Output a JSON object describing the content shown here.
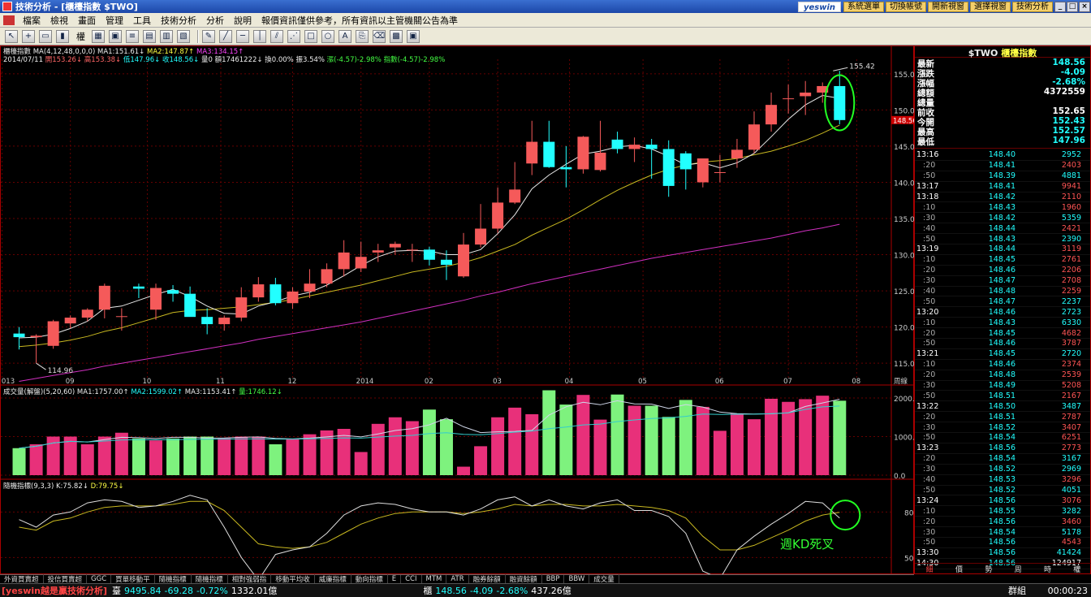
{
  "window": {
    "title": "技術分析 - [櫃檯指數 $TWO]",
    "brand": "yeswin",
    "buttons": [
      "系統選單",
      "切換帳號",
      "開新視窗",
      "選擇視窗",
      "技術分析"
    ]
  },
  "menu": [
    "檔案",
    "檢視",
    "畫面",
    "管理",
    "工具",
    "技術分析",
    "分析",
    "說明",
    "報價資訊僅供參考，所有資訊以主管機關公告為準"
  ],
  "toolbar": {
    "period": "權"
  },
  "kchart": {
    "name": "櫃檯指數",
    "ma_param": "MA(4,12,48,0,0,0)",
    "ma1": "MA1:151.61↓",
    "ma2": "MA2:147.87↑",
    "ma3": "MA3:134.15↑",
    "date": "2014/07/11",
    "open": "開153.26↓",
    "high": "高153.38↓",
    "low": "低147.96↓",
    "close": "收148.56↓",
    "vol": "量0",
    "amount": "額17461222↓",
    "turnover": "換0.00%",
    "amp": "振3.54%",
    "chg": "漲(-4.57)-2.98%",
    "idx": "指數(-4.57)-2.98%",
    "hi_label": "155.42",
    "lo_label": "114.96",
    "cur_price": "148.56",
    "yticks": [
      "155.00",
      "150.00",
      "145.00",
      "140.00",
      "135.00",
      "130.00",
      "125.00",
      "120.00",
      "115.00"
    ],
    "xlabels": [
      "2013",
      "09",
      "10",
      "11",
      "12",
      "2014",
      "02",
      "03",
      "04",
      "05",
      "06",
      "07",
      "08"
    ],
    "period": "周線",
    "annot": "週KD死叉"
  },
  "vchart": {
    "title": "成交量(解盤)(5,20,60)",
    "ma1": "MA1:1757.00↑",
    "ma2": "MA2:1599.02↑",
    "ma3": "MA3:1153.41↑",
    "amt": "量:1746.12↓",
    "yticks": [
      "2000.0",
      "1000.0",
      "0.0"
    ]
  },
  "kdchart": {
    "title": "隨機指標(9,3,3)",
    "k": "K:75.82↓",
    "d": "D:79.75↓",
    "yticks": [
      "80",
      "50"
    ]
  },
  "chart_data": {
    "type": "candlestick",
    "x": [
      "2013-08-02",
      "2013-08-09",
      "2013-08-16",
      "2013-08-23",
      "2013-08-30",
      "2013-09-06",
      "2013-09-13",
      "2013-09-20",
      "2013-09-27",
      "2013-10-04",
      "2013-10-11",
      "2013-10-18",
      "2013-10-25",
      "2013-11-01",
      "2013-11-08",
      "2013-11-15",
      "2013-11-22",
      "2013-11-29",
      "2013-12-06",
      "2013-12-13",
      "2013-12-20",
      "2013-12-27",
      "2014-01-03",
      "2014-01-10",
      "2014-01-17",
      "2014-01-24",
      "2014-02-07",
      "2014-02-14",
      "2014-02-21",
      "2014-02-28",
      "2014-03-07",
      "2014-03-14",
      "2014-03-21",
      "2014-03-28",
      "2014-04-03",
      "2014-04-11",
      "2014-04-18",
      "2014-04-25",
      "2014-05-02",
      "2014-05-09",
      "2014-05-16",
      "2014-05-23",
      "2014-05-30",
      "2014-06-06",
      "2014-06-13",
      "2014-06-20",
      "2014-06-27",
      "2014-07-04",
      "2014-07-11"
    ],
    "open": [
      119.1,
      118.6,
      117.4,
      120.5,
      121.3,
      122.4,
      121.4,
      125.6,
      122.4,
      125.1,
      124.6,
      121.4,
      120.4,
      121.3,
      124.1,
      125.9,
      123.3,
      124.9,
      126.0,
      128.0,
      128.1,
      130.3,
      131.0,
      130.6,
      130.7,
      129.3,
      127.0,
      131.4,
      133.6,
      137.2,
      142.6,
      145.6,
      142.1,
      141.8,
      141.7,
      145.9,
      144.6,
      145.2,
      144.6,
      144.0,
      140.0,
      141.4,
      143.3,
      144.5,
      148.0,
      151.6,
      151.9,
      152.4,
      153.3
    ],
    "high": [
      120.0,
      119.0,
      121.0,
      121.6,
      122.6,
      126.0,
      122.6,
      126.0,
      126.0,
      125.8,
      125.6,
      122.6,
      121.6,
      125.5,
      126.9,
      126.8,
      125.5,
      128.0,
      128.8,
      132.0,
      131.8,
      131.5,
      131.8,
      131.5,
      131.1,
      130.6,
      133.0,
      137.0,
      139.3,
      142.8,
      148.5,
      148.5,
      145.0,
      146.4,
      148.5,
      147.0,
      146.2,
      146.0,
      145.8,
      144.3,
      142.5,
      143.8,
      146.0,
      149.8,
      152.4,
      153.5,
      154.0,
      153.8,
      155.4
    ],
    "low": [
      116.9,
      115.0,
      117.0,
      119.8,
      120.8,
      121.2,
      119.5,
      124.0,
      121.0,
      123.5,
      121.5,
      119.0,
      119.5,
      120.8,
      123.5,
      123.0,
      122.5,
      124.0,
      125.5,
      127.0,
      127.6,
      129.0,
      130.0,
      129.0,
      128.5,
      126.5,
      126.8,
      131.0,
      133.0,
      137.0,
      141.0,
      142.0,
      139.3,
      141.2,
      141.5,
      144.0,
      142.8,
      140.5,
      138.0,
      139.0,
      139.3,
      140.0,
      142.0,
      144.0,
      147.0,
      149.5,
      149.3,
      151.0,
      148.0
    ],
    "close": [
      118.6,
      118.8,
      120.8,
      121.3,
      122.4,
      125.7,
      121.5,
      125.3,
      125.4,
      124.6,
      121.4,
      120.4,
      121.3,
      124.1,
      125.9,
      123.3,
      124.9,
      126.0,
      128.0,
      130.3,
      129.7,
      130.6,
      131.5,
      130.7,
      129.3,
      128.6,
      131.4,
      133.6,
      137.2,
      139.0,
      145.6,
      142.1,
      141.8,
      146.3,
      144.1,
      144.6,
      145.2,
      144.6,
      139.5,
      141.8,
      143.3,
      141.4,
      144.5,
      148.0,
      150.7,
      151.6,
      152.4,
      153.3,
      148.6
    ],
    "ma1": [
      118.5,
      118.6,
      119.0,
      119.8,
      120.8,
      122.6,
      122.9,
      123.7,
      124.5,
      125.2,
      124.2,
      122.9,
      121.9,
      121.8,
      122.9,
      123.5,
      124.3,
      124.8,
      125.8,
      127.1,
      128.5,
      129.7,
      130.5,
      130.6,
      130.5,
      130.0,
      130.0,
      130.7,
      132.9,
      135.5,
      139.1,
      141.0,
      142.5,
      143.9,
      144.3,
      144.9,
      145.1,
      144.6,
      143.6,
      142.4,
      142.7,
      142.0,
      142.7,
      144.0,
      146.3,
      148.7,
      150.7,
      152.0,
      151.6
    ],
    "ma2": [
      117.3,
      117.5,
      117.8,
      118.2,
      118.7,
      119.4,
      119.9,
      120.6,
      121.3,
      122.0,
      122.3,
      122.4,
      122.6,
      122.8,
      123.1,
      123.4,
      123.8,
      124.3,
      124.8,
      125.3,
      125.8,
      126.4,
      127.0,
      127.6,
      128.0,
      128.4,
      128.9,
      129.6,
      130.5,
      131.4,
      132.7,
      133.8,
      134.9,
      136.2,
      137.6,
      138.9,
      140.0,
      141.0,
      141.8,
      142.4,
      142.8,
      143.0,
      143.3,
      143.8,
      144.3,
      145.0,
      145.8,
      146.8,
      147.9
    ],
    "ma3": [
      112.5,
      112.9,
      113.3,
      113.7,
      114.1,
      114.6,
      115.0,
      115.4,
      115.8,
      116.2,
      116.6,
      117.0,
      117.4,
      117.8,
      118.3,
      118.7,
      119.1,
      119.5,
      119.9,
      120.3,
      120.7,
      121.2,
      121.7,
      122.2,
      122.7,
      123.2,
      123.7,
      124.3,
      124.8,
      125.4,
      126.0,
      126.5,
      127.0,
      127.5,
      128.0,
      128.5,
      129.0,
      129.5,
      129.9,
      130.3,
      130.7,
      131.1,
      131.5,
      131.9,
      132.3,
      132.8,
      133.3,
      133.7,
      134.2
    ],
    "volume": [
      700,
      800,
      1000,
      1000,
      800,
      1000,
      1100,
      950,
      900,
      950,
      1000,
      1000,
      960,
      1000,
      1000,
      800,
      940,
      1060,
      1160,
      1200,
      600,
      1330,
      1500,
      1400,
      1700,
      1450,
      220,
      750,
      1500,
      1750,
      1580,
      2200,
      1830,
      2080,
      1440,
      2090,
      1800,
      1800,
      1510,
      1950,
      1770,
      1150,
      1600,
      1450,
      1980,
      1900,
      1970,
      2060,
      1930
    ],
    "k": [
      75,
      70,
      78,
      80,
      86,
      88,
      87,
      83,
      84,
      87,
      91,
      88,
      70,
      50,
      35,
      52,
      55,
      57,
      66,
      78,
      84,
      86,
      85,
      82,
      80,
      80,
      78,
      82,
      88,
      90,
      84,
      88,
      84,
      82,
      86,
      88,
      81,
      81,
      77,
      66,
      41,
      36,
      55,
      64,
      72,
      79,
      87,
      86,
      76
    ],
    "d": [
      70,
      68,
      74,
      76,
      80,
      83,
      84,
      84,
      84,
      85,
      87,
      87,
      81,
      70,
      59,
      57,
      56,
      57,
      60,
      66,
      72,
      76,
      79,
      80,
      80,
      80,
      79,
      80,
      82,
      85,
      84,
      85,
      85,
      84,
      84,
      85,
      84,
      83,
      81,
      76,
      64,
      55,
      55,
      58,
      63,
      68,
      74,
      78,
      79.75
    ],
    "ylim": [
      113,
      157
    ],
    "vol_ylim": [
      0,
      2000
    ],
    "kd_ylim": [
      40,
      100
    ]
  },
  "quote": {
    "title_code": "$TWO",
    "title_name": "櫃檯指數",
    "rows": [
      [
        "最新",
        "148.56",
        "c"
      ],
      [
        "漲跌",
        "-4.09",
        "c"
      ],
      [
        "漲幅",
        "-2.68%",
        "c"
      ],
      [
        "總額",
        "4372559",
        "w"
      ],
      [
        "總量",
        "",
        "w"
      ],
      [
        "前收",
        "152.65",
        "w"
      ],
      [
        "今開",
        "152.43",
        "c"
      ],
      [
        "最高",
        "152.57",
        "c"
      ],
      [
        "最低",
        "147.96",
        "c"
      ]
    ]
  },
  "ticks": [
    [
      "13:16",
      "148.40",
      "2952",
      "c",
      0
    ],
    [
      ":20",
      "148.41",
      "2403",
      "r",
      1
    ],
    [
      ":50",
      "148.39",
      "4881",
      "c",
      1
    ],
    [
      "13:17",
      "148.41",
      "9941",
      "r",
      0
    ],
    [
      "13:18",
      "148.42",
      "2110",
      "r",
      0
    ],
    [
      ":10",
      "148.43",
      "1960",
      "r",
      1
    ],
    [
      ":30",
      "148.42",
      "5359",
      "c",
      1
    ],
    [
      ":40",
      "148.44",
      "2421",
      "r",
      1
    ],
    [
      ":50",
      "148.43",
      "2390",
      "c",
      1
    ],
    [
      "13:19",
      "148.44",
      "3119",
      "r",
      0
    ],
    [
      ":10",
      "148.45",
      "2761",
      "r",
      1
    ],
    [
      ":20",
      "148.46",
      "2206",
      "r",
      1
    ],
    [
      ":30",
      "148.47",
      "2708",
      "r",
      1
    ],
    [
      ":40",
      "148.48",
      "2259",
      "r",
      1
    ],
    [
      ":50",
      "148.47",
      "2237",
      "c",
      1
    ],
    [
      "13:20",
      "148.46",
      "2723",
      "c",
      0
    ],
    [
      ":10",
      "148.43",
      "6330",
      "c",
      1
    ],
    [
      ":20",
      "148.45",
      "4682",
      "r",
      1
    ],
    [
      ":50",
      "148.46",
      "3787",
      "r",
      1
    ],
    [
      "13:21",
      "148.45",
      "2720",
      "c",
      0
    ],
    [
      ":10",
      "148.46",
      "2374",
      "r",
      1
    ],
    [
      ":20",
      "148.48",
      "2539",
      "r",
      1
    ],
    [
      ":30",
      "148.49",
      "5208",
      "r",
      1
    ],
    [
      ":50",
      "148.51",
      "2167",
      "r",
      1
    ],
    [
      "13:22",
      "148.50",
      "3487",
      "c",
      0
    ],
    [
      ":20",
      "148.51",
      "2787",
      "r",
      1
    ],
    [
      ":30",
      "148.52",
      "3407",
      "r",
      1
    ],
    [
      ":50",
      "148.54",
      "6251",
      "r",
      1
    ],
    [
      "13:23",
      "148.56",
      "2773",
      "r",
      0
    ],
    [
      ":20",
      "148.54",
      "3167",
      "c",
      1
    ],
    [
      ":30",
      "148.52",
      "2969",
      "c",
      1
    ],
    [
      ":40",
      "148.53",
      "3296",
      "r",
      1
    ],
    [
      ":50",
      "148.52",
      "4051",
      "c",
      1
    ],
    [
      "13:24",
      "148.56",
      "3076",
      "r",
      0
    ],
    [
      ":10",
      "148.55",
      "3282",
      "c",
      1
    ],
    [
      ":20",
      "148.56",
      "3460",
      "r",
      1
    ],
    [
      ":30",
      "148.54",
      "5178",
      "c",
      1
    ],
    [
      ":50",
      "148.56",
      "4543",
      "r",
      1
    ],
    [
      "13:30",
      "148.56",
      "41424",
      "c",
      0
    ],
    [
      "14:30",
      "148.56",
      "124917",
      "w",
      0
    ]
  ],
  "rtabs": [
    "細",
    "價",
    "勢",
    "周",
    "時",
    "權"
  ],
  "bottom_tabs": [
    "外資買賣超",
    "投信買賣超",
    "GGC",
    "買單移動平",
    "隨機指標",
    "隨機指標",
    "相對強弱指",
    "移動平均收",
    "威廉指標",
    "動向指標",
    "E",
    "CCI",
    "MTM",
    "ATR",
    "融券餘額",
    "融資餘額",
    "BBP",
    "BBW",
    "成交量"
  ],
  "status": {
    "brand": "[yeswin越是贏技術分析]",
    "tw": "臺",
    "tw_val": "9495.84",
    "tw_chg": "-69.28",
    "tw_pct": "-0.72%",
    "tw_amt": "1332.01",
    "yi": "億",
    "otc": "櫃",
    "otc_val": "148.56",
    "otc_chg": "-4.09",
    "otc_pct": "-2.68%",
    "otc_amt": "437.26",
    "group": "群組",
    "clock": "00:00:23"
  }
}
